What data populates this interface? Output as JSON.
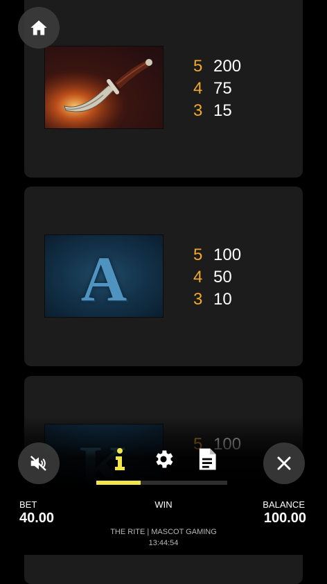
{
  "paytable": [
    {
      "symbol": "dagger-icon",
      "pays": [
        {
          "count": "5",
          "value": "200"
        },
        {
          "count": "4",
          "value": "75"
        },
        {
          "count": "3",
          "value": "15"
        }
      ]
    },
    {
      "symbol": "ace-symbol",
      "letter": "A",
      "pays": [
        {
          "count": "5",
          "value": "100"
        },
        {
          "count": "4",
          "value": "50"
        },
        {
          "count": "3",
          "value": "10"
        }
      ]
    },
    {
      "symbol": "king-symbol",
      "letter": "K",
      "pays": [
        {
          "count": "5",
          "value": "100"
        }
      ]
    }
  ],
  "menu": {
    "active_tab": "info",
    "progress": 0.34
  },
  "footer": {
    "bet_label": "BET",
    "bet_value": "40.00",
    "win_label": "WIN",
    "balance_label": "BALANCE",
    "balance_value": "100.00",
    "game_title": "THE RITE | MASCOT GAMING",
    "clock": "13:44:54"
  },
  "colors": {
    "accent": "#f0a92d",
    "progress": "#f2e64a",
    "card": "#1c1c1c"
  }
}
